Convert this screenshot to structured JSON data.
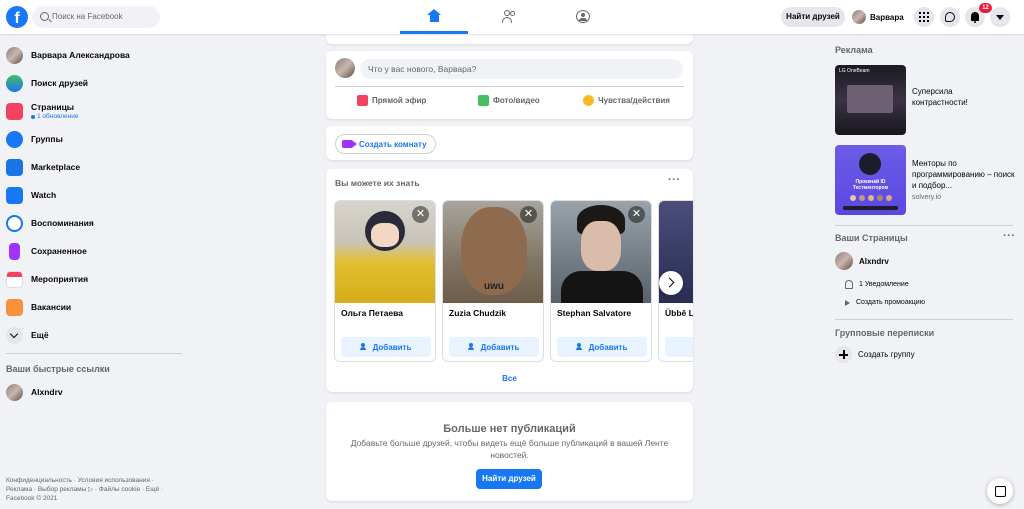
{
  "header": {
    "logo": "f",
    "search_placeholder": "Поиск на Facebook",
    "find_friends": "Найти друзей",
    "profile_name": "Варвара",
    "notification_count": "12"
  },
  "sidebar": {
    "items": [
      {
        "label": "Варвара Александрова",
        "icon": "avatar"
      },
      {
        "label": "Поиск друзей",
        "icon": "friends-icon"
      },
      {
        "label": "Страницы",
        "sub": "1 обновление",
        "icon": "flag-icon"
      },
      {
        "label": "Группы",
        "icon": "groups-icon"
      },
      {
        "label": "Marketplace",
        "icon": "shop-icon"
      },
      {
        "label": "Watch",
        "icon": "watch-icon"
      },
      {
        "label": "Воспоминания",
        "icon": "clock-icon"
      },
      {
        "label": "Сохраненное",
        "icon": "bookmark-icon"
      },
      {
        "label": "Мероприятия",
        "icon": "calendar-icon"
      },
      {
        "label": "Вакансии",
        "icon": "briefcase-icon"
      },
      {
        "label": "Ещё",
        "icon": "chevron-down-icon"
      }
    ],
    "shortcuts_title": "Ваши быстрые ссылки",
    "shortcut": "Alxndrv",
    "footer": {
      "line1": "Конфиденциальность · Условия использования ·",
      "line2": "Реклама · Выбор рекламы ▷ · Файлы cookie · Ещё ·",
      "line3": "Facebook © 2021"
    }
  },
  "composer": {
    "placeholder": "Что у вас нового, Варвара?",
    "live": "Прямой эфир",
    "photo": "Фото/видео",
    "feeling": "Чувства/действия"
  },
  "room": {
    "label": "Создать комнату"
  },
  "pymk": {
    "title": "Вы можете их знать",
    "add_label": "Добавить",
    "see_all": "Все",
    "people": [
      {
        "name": "Ольга Петаева"
      },
      {
        "name": "Zuzia Chudzik",
        "photo_text": "uwu"
      },
      {
        "name": "Stephan Salvatore"
      },
      {
        "name": "Übbê L"
      }
    ]
  },
  "no_more": {
    "title": "Больше нет публикаций",
    "text": "Добавьте больше друзей, чтобы видеть ещё больше публикаций в вашей Ленте новостей.",
    "button": "Найти друзей"
  },
  "right": {
    "ads_title": "Реклама",
    "ads": [
      {
        "title": "Суперсила контрастности!",
        "domain": "",
        "img_label": "LG OneBeam"
      },
      {
        "title": "Менторы по программированию – поиск и подбор...",
        "domain": "solvery.io",
        "img_label": "Прокачай ID\nТестментором"
      }
    ],
    "pages_title": "Ваши Страницы",
    "page_name": "Alxndrv",
    "page_notif": "1 Уведомление",
    "page_promo": "Создать промоакцию",
    "group_chats_title": "Групповые переписки",
    "create_group": "Создать группу"
  },
  "colors": {
    "brand": "#1877f2",
    "background": "#f0f2f5",
    "badge": "#e41e3f"
  }
}
